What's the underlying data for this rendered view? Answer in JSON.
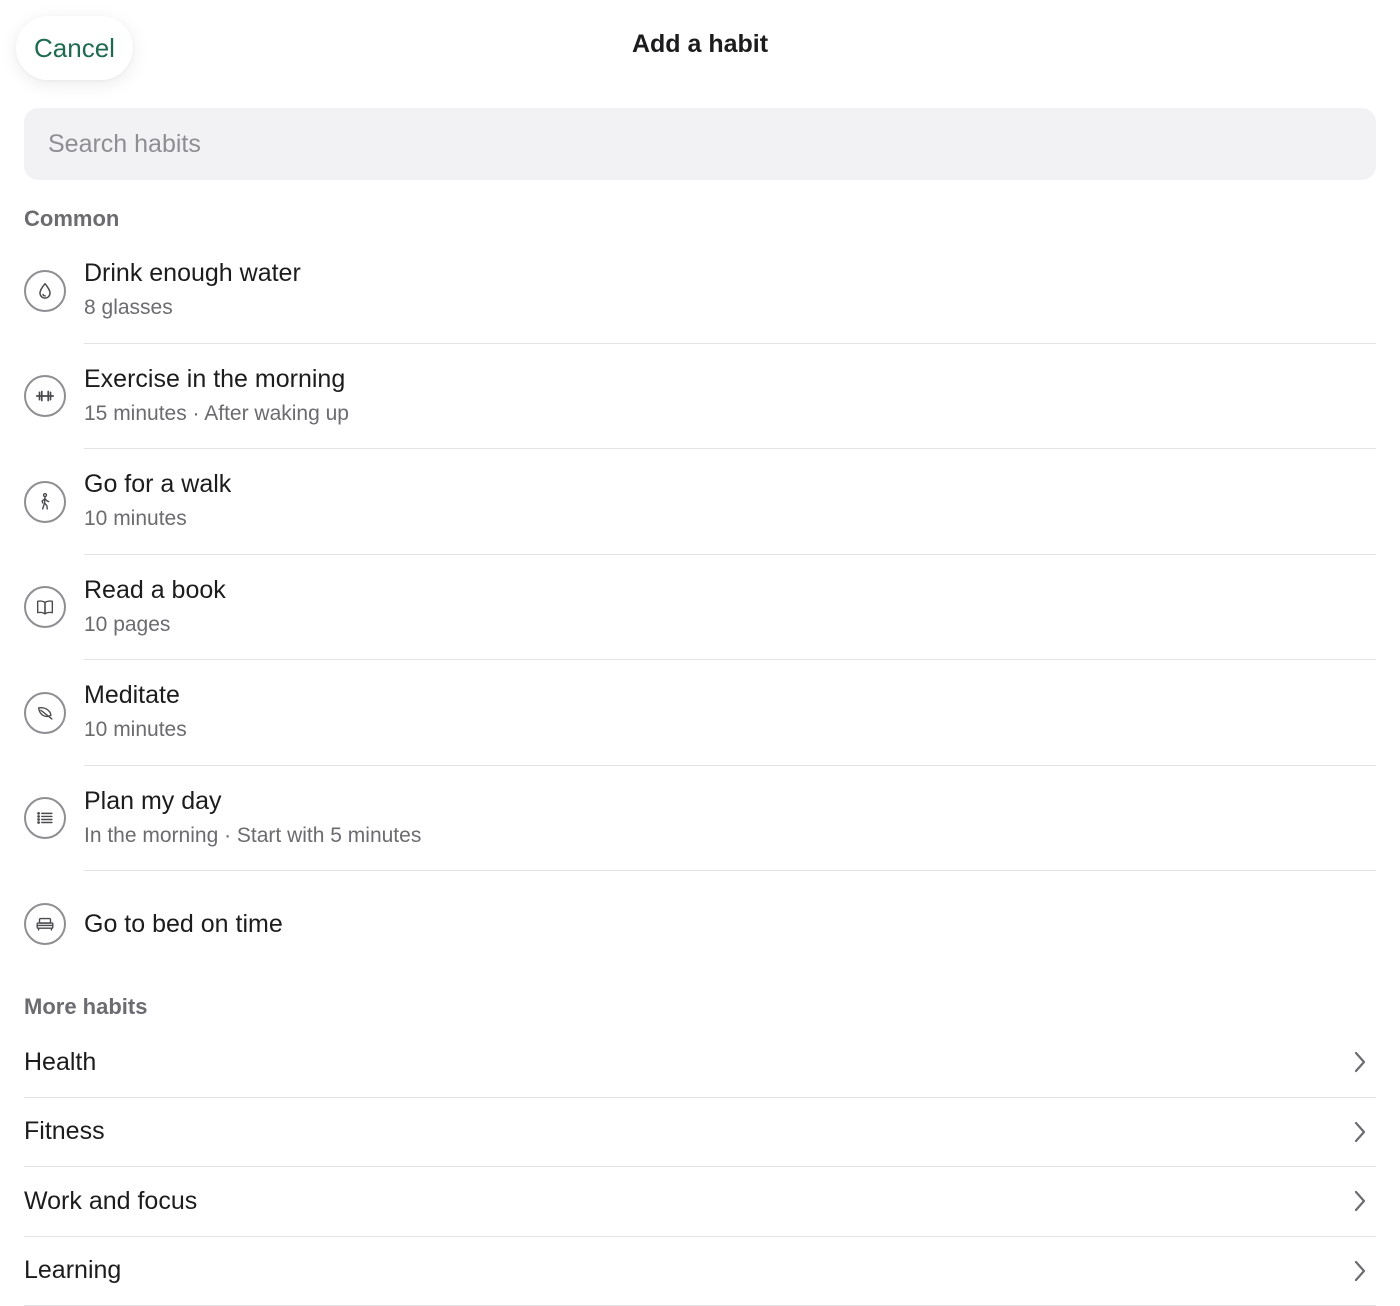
{
  "header": {
    "cancel_label": "Cancel",
    "title": "Add a habit"
  },
  "search": {
    "placeholder": "Search habits",
    "value": ""
  },
  "common": {
    "section_label": "Common",
    "items": [
      {
        "icon": "water-drop-icon",
        "title": "Drink enough water",
        "subtitle": "8 glasses"
      },
      {
        "icon": "dumbbell-icon",
        "title": "Exercise in the morning",
        "subtitle": "15 minutes · After waking up"
      },
      {
        "icon": "walking-person-icon",
        "title": "Go for a walk",
        "subtitle": "10 minutes"
      },
      {
        "icon": "book-icon",
        "title": "Read a book",
        "subtitle": "10 pages"
      },
      {
        "icon": "leaf-icon",
        "title": "Meditate",
        "subtitle": "10 minutes"
      },
      {
        "icon": "list-icon",
        "title": "Plan my day",
        "subtitle": "In the morning · Start with 5 minutes"
      },
      {
        "icon": "bed-icon",
        "title": "Go to bed on time",
        "subtitle": ""
      }
    ]
  },
  "more": {
    "section_label": "More habits",
    "items": [
      {
        "label": "Health"
      },
      {
        "label": "Fitness"
      },
      {
        "label": "Work and focus"
      },
      {
        "label": "Learning"
      }
    ]
  },
  "colors": {
    "accent": "#1f6b4f",
    "icon_stroke": "#8e8e93",
    "secondary_text": "#6b6b70",
    "search_bg": "#f2f2f4",
    "divider": "#e3e3e6"
  }
}
